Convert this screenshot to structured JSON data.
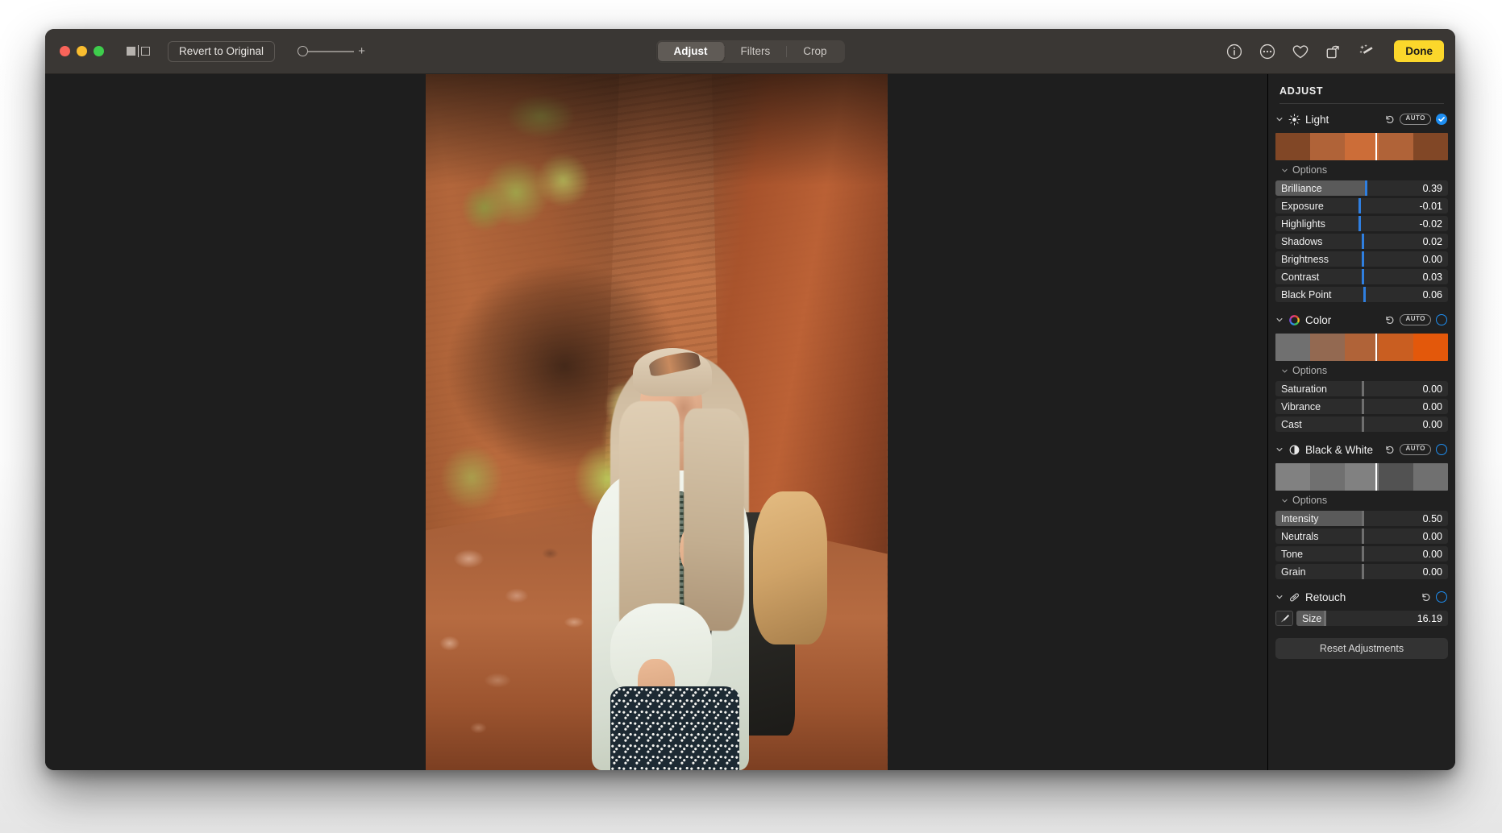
{
  "window": {
    "traffic_lights": [
      "close",
      "minimize",
      "maximize"
    ]
  },
  "toolbar": {
    "compare_icon": "split-compare-icon",
    "revert_label": "Revert to Original",
    "zoom": {
      "plus_label": "+",
      "value": 0
    },
    "segments": [
      {
        "label": "Adjust",
        "active": true
      },
      {
        "label": "Filters",
        "active": false
      },
      {
        "label": "Crop",
        "active": false
      }
    ],
    "right_icons": [
      {
        "name": "info-icon"
      },
      {
        "name": "more-options-icon"
      },
      {
        "name": "favorite-heart-icon"
      },
      {
        "name": "rotate-icon"
      },
      {
        "name": "auto-enhance-wand-icon"
      }
    ],
    "done_label": "Done",
    "done_color": "#fbd72b"
  },
  "panel": {
    "title": "ADJUST",
    "accent_color": "#1e8ef1",
    "auto_label": "AUTO",
    "options_label": "Options",
    "reset_label": "Reset Adjustments",
    "sections": [
      {
        "name": "Light",
        "icon": "sun-icon",
        "has_auto": true,
        "enabled": true,
        "sliders": [
          {
            "label": "Brilliance",
            "value": "0.39",
            "pos": 52,
            "fill": 52,
            "accent": true
          },
          {
            "label": "Exposure",
            "value": "-0.01",
            "pos": 48,
            "fill": 0,
            "accent": true
          },
          {
            "label": "Highlights",
            "value": "-0.02",
            "pos": 48,
            "fill": 0,
            "accent": true
          },
          {
            "label": "Shadows",
            "value": "0.02",
            "pos": 50,
            "fill": 0,
            "accent": true
          },
          {
            "label": "Brightness",
            "value": "0.00",
            "pos": 50,
            "fill": 0,
            "accent": true
          },
          {
            "label": "Contrast",
            "value": "0.03",
            "pos": 50,
            "fill": 0,
            "accent": true
          },
          {
            "label": "Black Point",
            "value": "0.06",
            "pos": 51,
            "fill": 0,
            "accent": true
          }
        ]
      },
      {
        "name": "Color",
        "icon": "color-wheel-icon",
        "has_auto": true,
        "enabled": false,
        "sliders": [
          {
            "label": "Saturation",
            "value": "0.00",
            "pos": 50,
            "fill": 0,
            "accent": false
          },
          {
            "label": "Vibrance",
            "value": "0.00",
            "pos": 50,
            "fill": 0,
            "accent": false
          },
          {
            "label": "Cast",
            "value": "0.00",
            "pos": 50,
            "fill": 0,
            "accent": false
          }
        ]
      },
      {
        "name": "Black & White",
        "icon": "half-circle-icon",
        "has_auto": true,
        "enabled": false,
        "sliders": [
          {
            "label": "Intensity",
            "value": "0.50",
            "pos": 50,
            "fill": 50,
            "accent": false
          },
          {
            "label": "Neutrals",
            "value": "0.00",
            "pos": 50,
            "fill": 0,
            "accent": false
          },
          {
            "label": "Tone",
            "value": "0.00",
            "pos": 50,
            "fill": 0,
            "accent": false
          },
          {
            "label": "Grain",
            "value": "0.00",
            "pos": 50,
            "fill": 0,
            "accent": false
          }
        ]
      },
      {
        "name": "Retouch",
        "icon": "bandage-icon",
        "has_auto": false,
        "enabled": false,
        "sliders": [
          {
            "label": "Size",
            "value": "16.19",
            "pos": 18,
            "fill": 18,
            "accent": false
          }
        ]
      }
    ]
  },
  "canvas": {
    "photo_alt": "Woman with blonde hair and backpack standing in a red sandstone canyon"
  }
}
